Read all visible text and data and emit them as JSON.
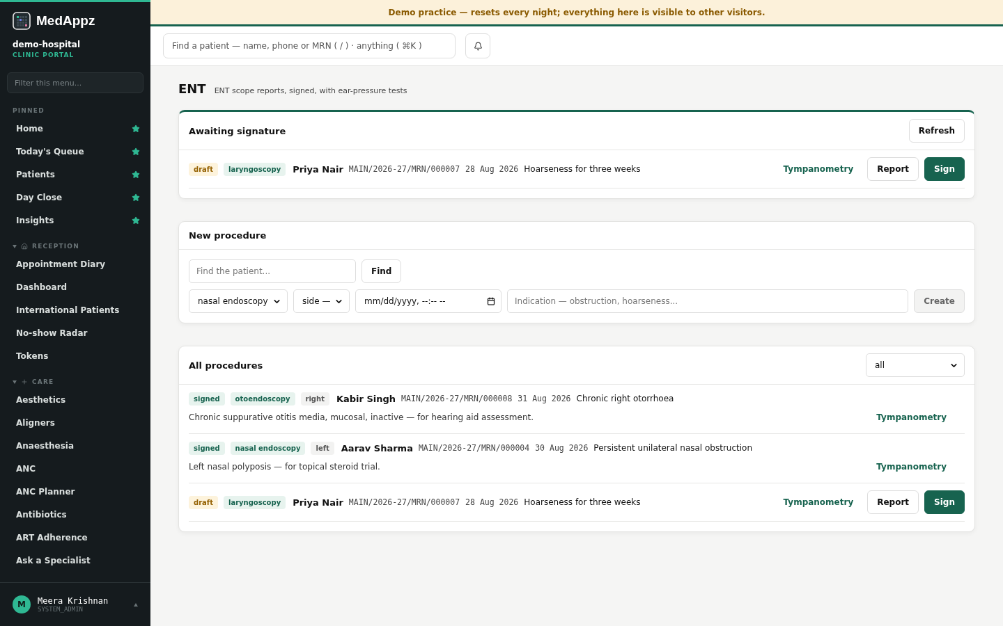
{
  "brand": {
    "name": "MedAppz",
    "org": "demo-hospital",
    "portal": "CLINIC PORTAL"
  },
  "sidebar": {
    "filter_placeholder": "Filter this menu...",
    "pinned": {
      "label": "PINNED",
      "items": [
        "Home",
        "Today's Queue",
        "Patients",
        "Day Close",
        "Insights"
      ]
    },
    "groups": [
      {
        "label": "RECEPTION",
        "expanded": true,
        "items": [
          "Appointment Diary",
          "Dashboard",
          "International Patients",
          "No-show Radar",
          "Tokens"
        ]
      },
      {
        "label": "CARE",
        "expanded": true,
        "items": [
          "Aesthetics",
          "Aligners",
          "Anaesthesia",
          "ANC",
          "ANC Planner",
          "Antibiotics",
          "ART Adherence",
          "Ask a Specialist"
        ]
      }
    ],
    "user": {
      "initial": "M",
      "name": "Meera Krishnan",
      "role": "SYSTEM_ADMIN"
    }
  },
  "banner": "Demo practice — resets every night; everything here is visible to other visitors.",
  "search": {
    "placeholder": "Find a patient — name, phone or MRN ( / ) · anything ( ⌘K )"
  },
  "page": {
    "title": "ENT",
    "subtitle": "ENT scope reports, signed, with ear-pressure tests"
  },
  "awaiting": {
    "title": "Awaiting signature",
    "button": "Refresh",
    "rows": [
      {
        "status": "draft",
        "procedure": "laryngoscopy",
        "patient": "Priya Nair",
        "mrn": "MAIN/2026-27/MRN/000007",
        "date": "28 Aug 2026",
        "complaint": "Hoarseness for three weeks",
        "link": "Tympanometry",
        "buttons": [
          "Report",
          "Sign"
        ]
      }
    ]
  },
  "new_procedure": {
    "title": "New procedure",
    "patient_placeholder": "Find the patient...",
    "find_button": "Find",
    "procedure": "nasal endoscopy",
    "side": "side —",
    "datetime": "mm/dd/yyyy, --:-- --",
    "indication_placeholder": "Indication — obstruction, hoarseness...",
    "create_button": "Create",
    "create_disabled": true
  },
  "all": {
    "title": "All procedures",
    "filter": "all",
    "rows": [
      {
        "status": "signed",
        "procedure": "otoendoscopy",
        "side": "right",
        "patient": "Kabir Singh",
        "mrn": "MAIN/2026-27/MRN/000008",
        "date": "31 Aug 2026",
        "complaint": "Chronic right otorrhoea",
        "note": "Chronic suppurative otitis media, mucosal, inactive — for hearing aid assessment.",
        "link": "Tympanometry"
      },
      {
        "status": "signed",
        "procedure": "nasal endoscopy",
        "side": "left",
        "patient": "Aarav Sharma",
        "mrn": "MAIN/2026-27/MRN/000004",
        "date": "30 Aug 2026",
        "complaint": "Persistent unilateral nasal obstruction",
        "note": "Left nasal polyposis — for topical steroid trial.",
        "link": "Tympanometry"
      },
      {
        "status": "draft",
        "procedure": "laryngoscopy",
        "patient": "Priya Nair",
        "mrn": "MAIN/2026-27/MRN/000007",
        "date": "28 Aug 2026",
        "complaint": "Hoarseness for three weeks",
        "link": "Tympanometry",
        "buttons": [
          "Report",
          "Sign"
        ]
      }
    ]
  }
}
